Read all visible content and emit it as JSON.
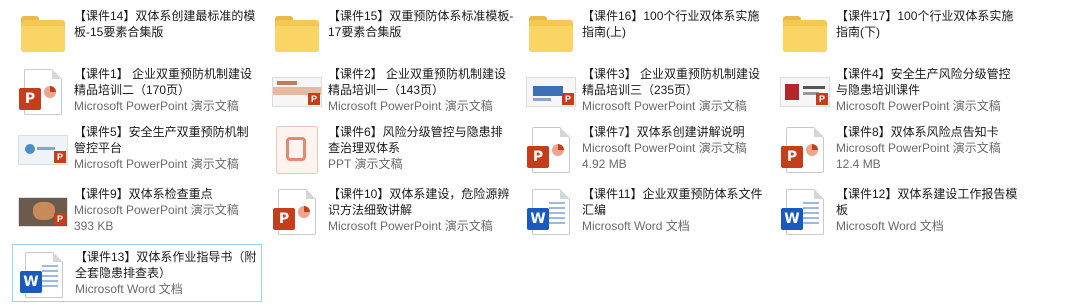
{
  "items": [
    {
      "name": "【课件14】双体系创建最标准的模板-15要素合集版",
      "meta": "",
      "size": "",
      "icon": "folder-icon"
    },
    {
      "name": "【课件15】双重预防体系标准模板-17要素合集版",
      "meta": "",
      "size": "",
      "icon": "folder-icon"
    },
    {
      "name": "【课件16】100个行业双体系实施指南(上)",
      "meta": "",
      "size": "",
      "icon": "folder-icon"
    },
    {
      "name": "【课件17】100个行业双体系实施指南(下)",
      "meta": "",
      "size": "",
      "icon": "folder-icon"
    },
    {
      "name": "【课件1】 企业双重预防机制建设精品培训二（170页）",
      "meta": "Microsoft PowerPoint 演示文稿",
      "size": "",
      "icon": "powerpoint-icon"
    },
    {
      "name": "【课件2】 企业双重预防机制建设精品培训一（143页）",
      "meta": "Microsoft PowerPoint 演示文稿",
      "size": "",
      "icon": "slide-thumbnail-icon"
    },
    {
      "name": "【课件3】 企业双重预防机制建设精品培训三（235页）",
      "meta": "Microsoft PowerPoint 演示文稿",
      "size": "",
      "icon": "slide-thumbnail-icon"
    },
    {
      "name": "【课件4】安全生产风险分级管控与隐患培训课件",
      "meta": "Microsoft PowerPoint 演示文稿",
      "size": "",
      "icon": "slide-thumbnail-icon"
    },
    {
      "name": "【课件5】安全生产双重预防机制管控平台",
      "meta": "Microsoft PowerPoint 演示文稿",
      "size": "",
      "icon": "slide-thumbnail-icon"
    },
    {
      "name": "【课件6】风险分级管控与隐患排查治理双体系",
      "meta": "PPT 演示文稿",
      "size": "",
      "icon": "ppt-generic-icon"
    },
    {
      "name": "【课件7】双体系创建讲解说明",
      "meta": "Microsoft PowerPoint 演示文稿",
      "size": "4.92 MB",
      "icon": "powerpoint-icon"
    },
    {
      "name": "【课件8】双体系风险点告知卡",
      "meta": "Microsoft PowerPoint 演示文稿",
      "size": "12.4 MB",
      "icon": "powerpoint-icon"
    },
    {
      "name": "【课件9】双体系检查重点",
      "meta": "Microsoft PowerPoint 演示文稿",
      "size": "393 KB",
      "icon": "slide-thumbnail-icon"
    },
    {
      "name": "【课件10】双体系建设，危险源辨识方法细致讲解",
      "meta": "Microsoft PowerPoint 演示文稿",
      "size": "",
      "icon": "powerpoint-icon"
    },
    {
      "name": "【课件11】企业双重预防体系文件汇编",
      "meta": "Microsoft Word 文档",
      "size": "",
      "icon": "word-icon"
    },
    {
      "name": "【课件12】双体系建设工作报告模板",
      "meta": "Microsoft Word 文档",
      "size": "",
      "icon": "word-icon"
    },
    {
      "name": "【课件13】双体系作业指导书（附全套隐患排查表）",
      "meta": "Microsoft Word 文档",
      "size": "",
      "icon": "word-icon"
    }
  ],
  "colors": {
    "ppt": "#c43e1c",
    "word": "#185abd",
    "folder": "#f4c952",
    "selection": "#99d1ff"
  }
}
